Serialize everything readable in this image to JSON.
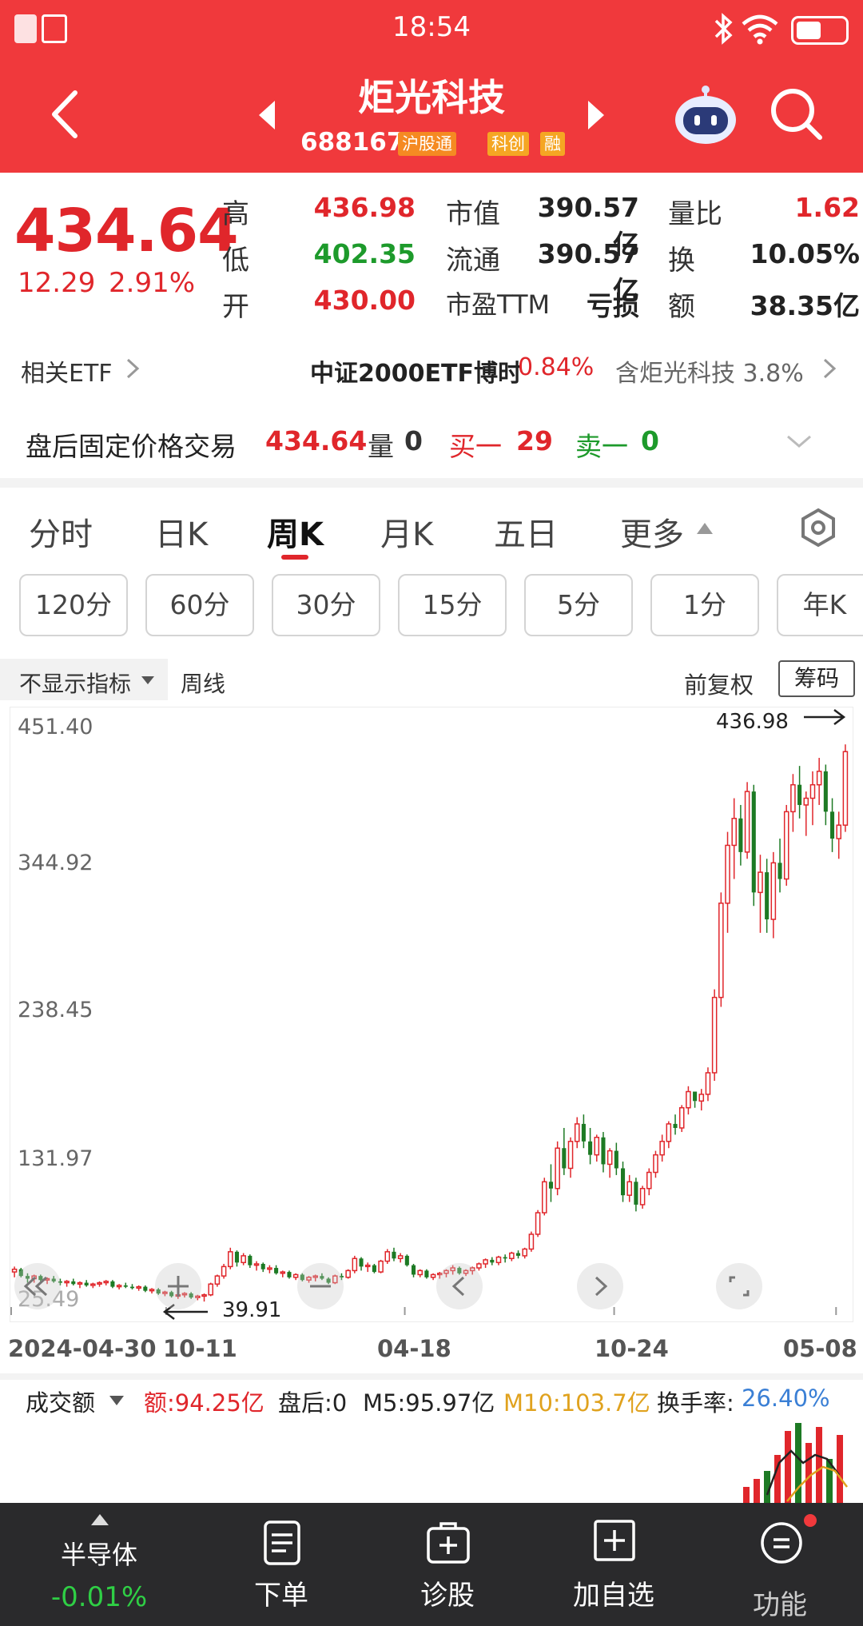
{
  "status_bar": {
    "time": "18:54"
  },
  "header": {
    "title": "炬光科技",
    "code": "688167",
    "tags": [
      "沪股通",
      "科创",
      "融"
    ]
  },
  "quote": {
    "price": "434.64",
    "change": "12.29",
    "change_pct": "2.91%",
    "high_label": "高",
    "high": "436.98",
    "low_label": "低",
    "low": "402.35",
    "open_label": "开",
    "open": "430.00",
    "mktcap_label": "市值",
    "mktcap": "390.57亿",
    "float_label": "流通",
    "float": "390.57亿",
    "pe_label": "市盈TTM",
    "pe": "亏损",
    "volratio_label": "量比",
    "volratio": "1.62",
    "turnover_label": "换",
    "turnover": "10.05%",
    "amount_label": "额",
    "amount": "38.35亿"
  },
  "etf": {
    "label": "相关ETF",
    "name": "中证2000ETF博时",
    "pct": "0.84%",
    "contain": "含炬光科技 3.8%"
  },
  "after_hours": {
    "label": "盘后固定价格交易",
    "price": "434.64",
    "vol_label": "量",
    "vol": "0",
    "buy_label": "买一",
    "buy": "29",
    "sell_label": "卖一",
    "sell": "0"
  },
  "tabs": [
    "分时",
    "日K",
    "周K",
    "月K",
    "五日",
    "更多"
  ],
  "active_tab": "周K",
  "periods": [
    "120分",
    "60分",
    "30分",
    "15分",
    "5分",
    "1分",
    "年K"
  ],
  "chart_toolbar": {
    "indicator": "不显示指标",
    "line_type": "周线",
    "adjust": "前复权",
    "chip": "筹码"
  },
  "chart_data": {
    "type": "candlestick",
    "y_ticks": [
      "451.40",
      "344.92",
      "238.45",
      "131.97",
      "25.49"
    ],
    "ylim": [
      25.49,
      451.4
    ],
    "x_labels": [
      "2024-04-30",
      "10-11",
      "04-18",
      "10-24",
      "05-08"
    ],
    "max_label": "436.98",
    "min_label": "39.91",
    "candles": [
      [
        48,
        52,
        44,
        50
      ],
      [
        50,
        51,
        44,
        45
      ],
      [
        45,
        47,
        40,
        43
      ],
      [
        43,
        46,
        40,
        45
      ],
      [
        45,
        46,
        41,
        42
      ],
      [
        42,
        44,
        39,
        43
      ],
      [
        43,
        45,
        40,
        41
      ],
      [
        41,
        43,
        38,
        40
      ],
      [
        40,
        42,
        37,
        41
      ],
      [
        41,
        43,
        38,
        39
      ],
      [
        39,
        41,
        36,
        40
      ],
      [
        40,
        42,
        37,
        38
      ],
      [
        38,
        40,
        36,
        39
      ],
      [
        39,
        41,
        37,
        40
      ],
      [
        40,
        42,
        38,
        41
      ],
      [
        41,
        42,
        36,
        37
      ],
      [
        37,
        39,
        35,
        38
      ],
      [
        38,
        40,
        36,
        37
      ],
      [
        37,
        39,
        35,
        36
      ],
      [
        36,
        38,
        34,
        37
      ],
      [
        37,
        38,
        33,
        34
      ],
      [
        34,
        36,
        32,
        35
      ],
      [
        35,
        36,
        31,
        32
      ],
      [
        32,
        34,
        30,
        33
      ],
      [
        33,
        34,
        29,
        30
      ],
      [
        30,
        32,
        28,
        31
      ],
      [
        31,
        33,
        29,
        32
      ],
      [
        32,
        33,
        28,
        29
      ],
      [
        29,
        31,
        27,
        30
      ],
      [
        30,
        32,
        26,
        31
      ],
      [
        31,
        40,
        30,
        39
      ],
      [
        39,
        46,
        37,
        45
      ],
      [
        45,
        54,
        43,
        52
      ],
      [
        52,
        66,
        50,
        63
      ],
      [
        63,
        64,
        52,
        55
      ],
      [
        55,
        62,
        53,
        60
      ],
      [
        60,
        61,
        51,
        53
      ],
      [
        53,
        56,
        49,
        54
      ],
      [
        54,
        55,
        48,
        50
      ],
      [
        50,
        53,
        47,
        51
      ],
      [
        51,
        53,
        46,
        47
      ],
      [
        47,
        49,
        44,
        48
      ],
      [
        48,
        49,
        43,
        44
      ],
      [
        44,
        47,
        42,
        46
      ],
      [
        46,
        47,
        41,
        42
      ],
      [
        42,
        45,
        40,
        44
      ],
      [
        44,
        46,
        41,
        45
      ],
      [
        45,
        47,
        42,
        43
      ],
      [
        43,
        44,
        39,
        40
      ],
      [
        40,
        46,
        39,
        45
      ],
      [
        45,
        47,
        42,
        44
      ],
      [
        44,
        50,
        43,
        49
      ],
      [
        49,
        60,
        47,
        58
      ],
      [
        58,
        59,
        49,
        52
      ],
      [
        52,
        55,
        48,
        53
      ],
      [
        53,
        54,
        47,
        48
      ],
      [
        48,
        57,
        47,
        56
      ],
      [
        56,
        65,
        54,
        63
      ],
      [
        63,
        66,
        56,
        58
      ],
      [
        58,
        62,
        55,
        60
      ],
      [
        60,
        61,
        52,
        53
      ],
      [
        53,
        54,
        44,
        46
      ],
      [
        46,
        50,
        44,
        49
      ],
      [
        49,
        50,
        43,
        44
      ],
      [
        44,
        47,
        42,
        46
      ],
      [
        46,
        48,
        43,
        47
      ],
      [
        47,
        50,
        44,
        49
      ],
      [
        49,
        53,
        46,
        51
      ],
      [
        51,
        52,
        46,
        47
      ],
      [
        47,
        50,
        45,
        49
      ],
      [
        49,
        52,
        46,
        51
      ],
      [
        51,
        55,
        49,
        54
      ],
      [
        54,
        58,
        51,
        57
      ],
      [
        57,
        59,
        53,
        55
      ],
      [
        55,
        60,
        53,
        59
      ],
      [
        59,
        61,
        55,
        58
      ],
      [
        58,
        63,
        56,
        62
      ],
      [
        62,
        64,
        58,
        60
      ],
      [
        60,
        66,
        58,
        65
      ],
      [
        65,
        78,
        63,
        76
      ],
      [
        76,
        94,
        74,
        92
      ],
      [
        92,
        118,
        90,
        115
      ],
      [
        115,
        128,
        100,
        110
      ],
      [
        110,
        145,
        105,
        140
      ],
      [
        140,
        155,
        120,
        125
      ],
      [
        125,
        148,
        118,
        145
      ],
      [
        145,
        163,
        140,
        158
      ],
      [
        158,
        165,
        140,
        145
      ],
      [
        145,
        155,
        128,
        135
      ],
      [
        135,
        150,
        130,
        148
      ],
      [
        148,
        152,
        122,
        128
      ],
      [
        128,
        140,
        118,
        138
      ],
      [
        138,
        144,
        120,
        125
      ],
      [
        125,
        130,
        100,
        105
      ],
      [
        105,
        120,
        100,
        115
      ],
      [
        115,
        118,
        93,
        98
      ],
      [
        98,
        112,
        95,
        110
      ],
      [
        110,
        125,
        105,
        122
      ],
      [
        122,
        138,
        118,
        135
      ],
      [
        135,
        150,
        130,
        145
      ],
      [
        145,
        160,
        140,
        158
      ],
      [
        158,
        165,
        150,
        155
      ],
      [
        155,
        172,
        152,
        170
      ],
      [
        170,
        186,
        165,
        182
      ],
      [
        182,
        175,
        170,
        175
      ],
      [
        175,
        184,
        168,
        180
      ],
      [
        180,
        200,
        175,
        196
      ],
      [
        196,
        258,
        190,
        252
      ],
      [
        252,
        330,
        245,
        322
      ],
      [
        322,
        375,
        300,
        365
      ],
      [
        365,
        400,
        340,
        385
      ],
      [
        385,
        395,
        350,
        360
      ],
      [
        360,
        412,
        355,
        405
      ],
      [
        405,
        410,
        320,
        330
      ],
      [
        330,
        358,
        300,
        345
      ],
      [
        345,
        355,
        300,
        310
      ],
      [
        310,
        360,
        296,
        352
      ],
      [
        352,
        370,
        330,
        340
      ],
      [
        340,
        395,
        335,
        390
      ],
      [
        390,
        418,
        375,
        410
      ],
      [
        410,
        424,
        385,
        395
      ],
      [
        395,
        405,
        372,
        400
      ],
      [
        400,
        420,
        380,
        410
      ],
      [
        410,
        430,
        395,
        420
      ],
      [
        420,
        425,
        380,
        390
      ],
      [
        390,
        400,
        360,
        370
      ],
      [
        370,
        390,
        355,
        380
      ],
      [
        380,
        440,
        375,
        434.64
      ]
    ]
  },
  "volume_bar": {
    "label": "成交额",
    "amount": "额:94.25亿",
    "after": "盘后:0",
    "m5": "M5:95.97亿",
    "m10": "M10:103.7亿",
    "turnover_label": "换手率:",
    "turnover": "26.40%",
    "series": [
      20,
      30,
      40,
      60,
      90,
      100,
      75,
      95,
      55,
      85
    ]
  },
  "bottom_nav": {
    "sector": "半导体",
    "sector_pct": "-0.01%",
    "order": "下单",
    "diagnose": "诊股",
    "watch": "加自选",
    "func": "功能"
  },
  "colors": {
    "up": "#e0262b",
    "down": "#1d7a24",
    "header": "#f0393c",
    "m5": "#222222",
    "m10": "#e0a21e",
    "turnover": "#3a7fd5"
  }
}
